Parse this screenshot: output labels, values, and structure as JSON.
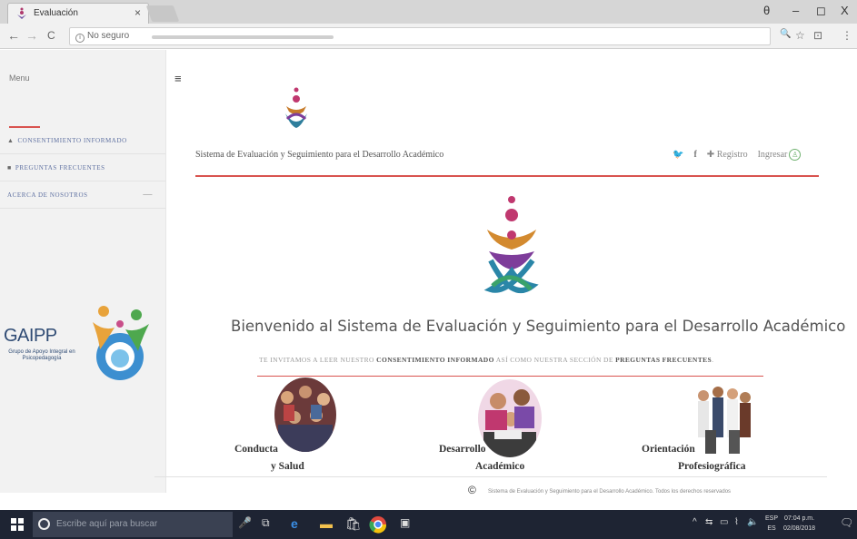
{
  "browser": {
    "tab_title": "Evaluación",
    "tab_close": "×",
    "window_controls": {
      "account": "θ",
      "minimize": "–",
      "maximize": "◻",
      "close": "X"
    },
    "nav": {
      "back": "←",
      "forward": "→",
      "reload": "C"
    },
    "address": {
      "security_label": "No seguro"
    },
    "toolbar_icons": {
      "zoom": "🔍",
      "star": "☆",
      "extension": "⊡",
      "menu": "⋮"
    }
  },
  "sidebar": {
    "menu_title": "Menu",
    "items": [
      {
        "icon": "▲",
        "label": "CONSENTIMIENTO INFORMADO"
      },
      {
        "icon": "■",
        "label": "PREGUNTAS FRECUENTES"
      },
      {
        "icon": "",
        "label": "ACERCA DE NOSOTROS",
        "caret": "—"
      }
    ],
    "logo": {
      "name": "GAIPP",
      "subtitle": "Grupo de Apoyo Integral en Psicopedagogía"
    }
  },
  "header": {
    "hamburger": "≡",
    "site_title": "Sistema de Evaluación y Seguimiento para el Desarrollo Académico",
    "twitter": "🐦",
    "facebook": "f",
    "registro_label": "Registro",
    "registro_icon": "✚",
    "ingresar_label": "Ingresar",
    "ingresar_icon": "♙"
  },
  "main": {
    "welcome": "Bienvenido al Sistema de Evaluación y Seguimiento para el Desarrollo Académico",
    "invite": {
      "part1": "TE INVITAMOS A LEER NUESTRO ",
      "link1": "CONSENTIMIENTO INFORMADO",
      "part2": " ASÍ COMO NUESTRA SECCIÓN DE ",
      "link2": "PREGUNTAS FRECUENTES",
      "part3": "."
    },
    "cards": [
      {
        "line1": "Conducta",
        "line2": "y Salud"
      },
      {
        "line1": "Desarrollo",
        "line2": "Académico"
      },
      {
        "line1": "Orientación",
        "line2": "Profesiográfica"
      }
    ]
  },
  "footer": {
    "copyright_symbol": "©",
    "text": "Sistema de Evaluación y Seguimiento para el Desarrollo Académico. Todos los derechos reservados"
  },
  "taskbar": {
    "search_placeholder": "Escribe aquí para buscar",
    "lang_line1": "ESP",
    "lang_line2": "ES",
    "time": "07:04 p.m.",
    "date": "02/08/2018"
  },
  "colors": {
    "accent_red": "#d9534f",
    "sidebar_bg": "#f2f2f2",
    "taskbar_bg": "#1e2433"
  }
}
